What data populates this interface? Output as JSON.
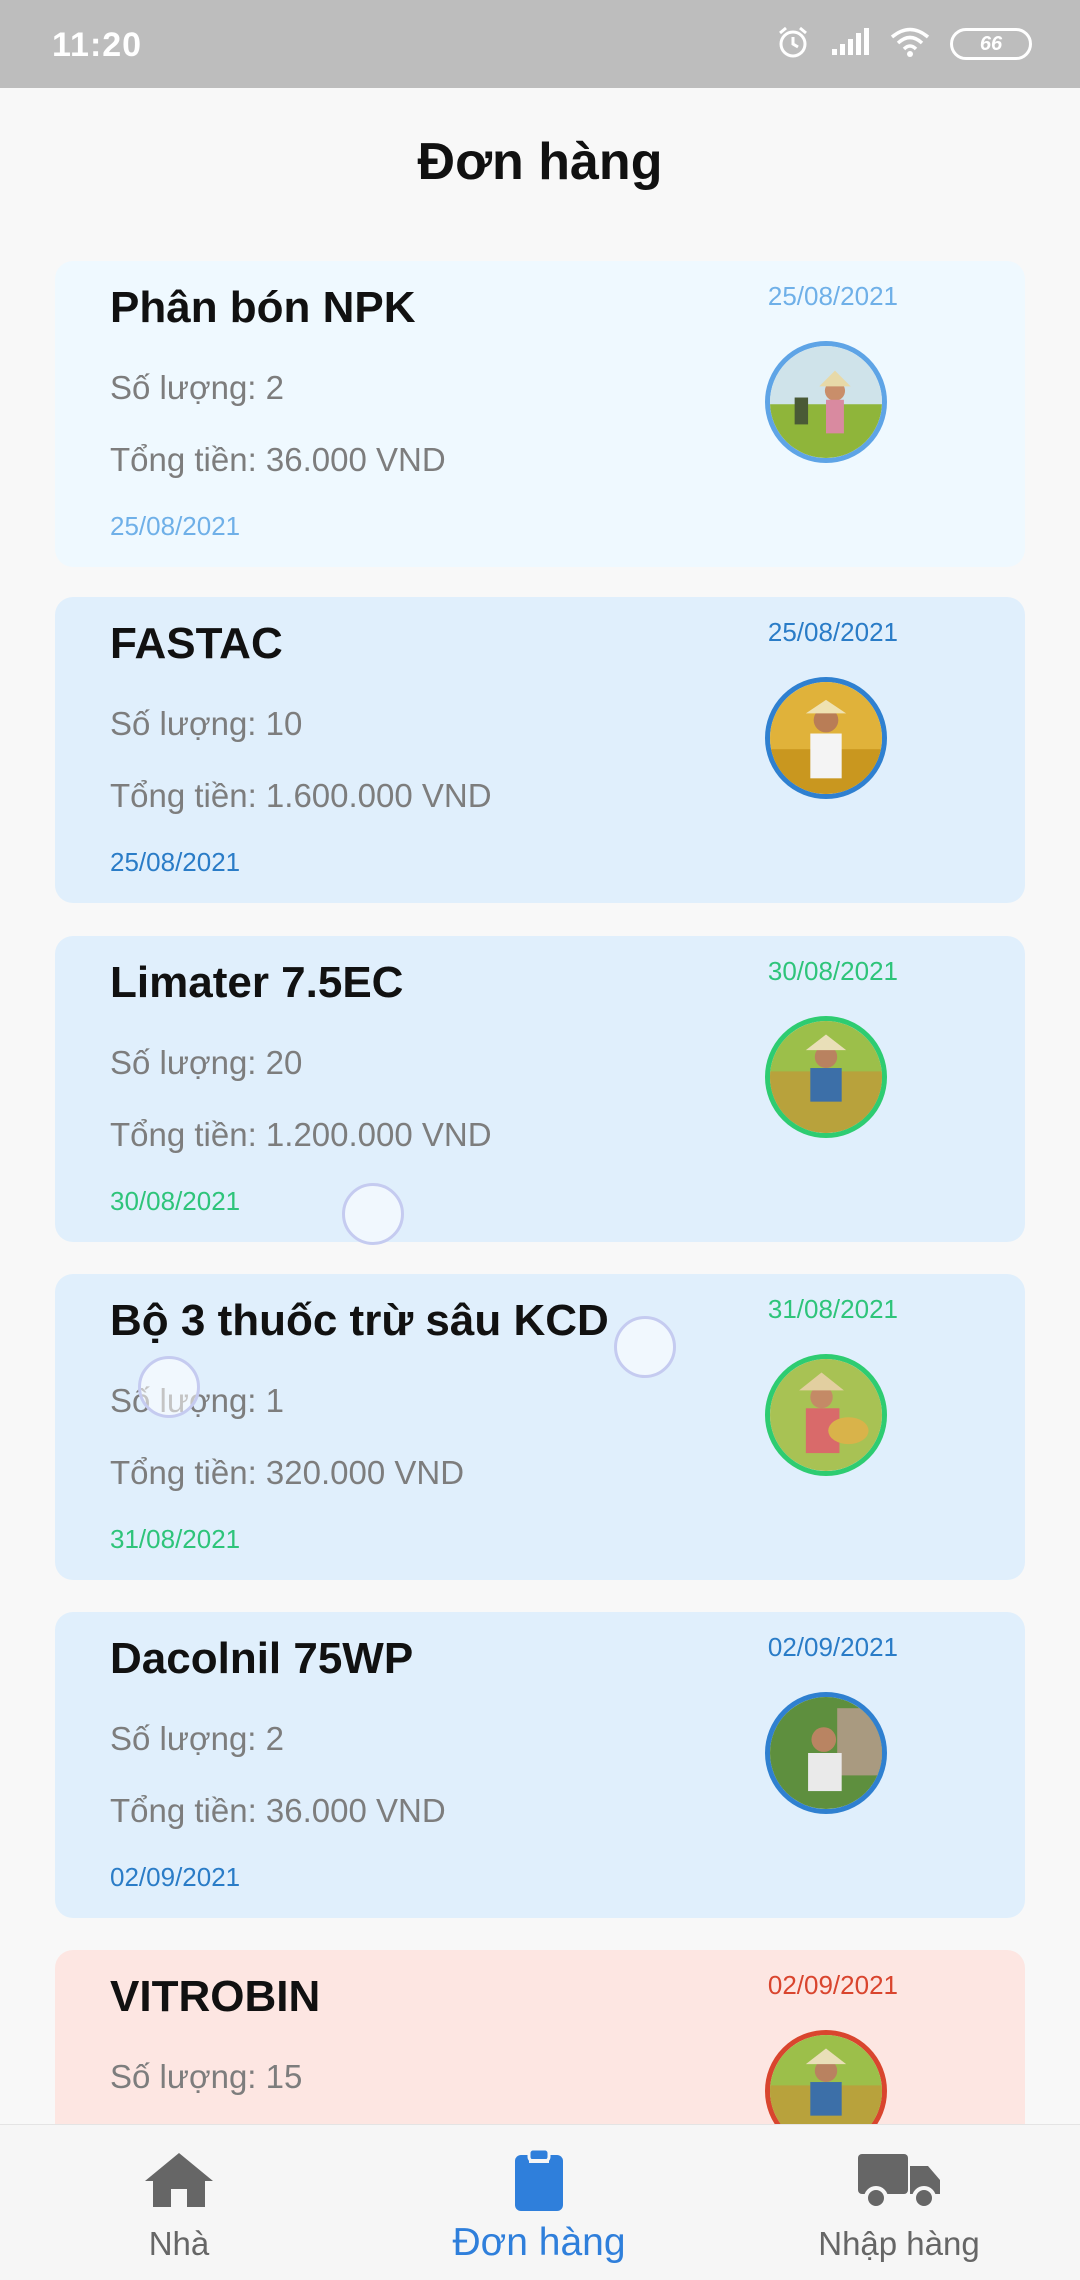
{
  "status_bar": {
    "time": "11:20",
    "battery": "66"
  },
  "page": {
    "title": "Đơn hàng"
  },
  "orders": [
    {
      "name": "Phân bón NPK",
      "quantity": "Số lượng: 2",
      "total": "Tổng tiền: 36.000 VND",
      "date": "25/08/2021",
      "bg": "#eff9ff",
      "date_color": "#6fb0e8",
      "ring": "#5ea4e6"
    },
    {
      "name": "FASTAC",
      "quantity": "Số lượng: 10",
      "total": "Tổng tiền: 1.600.000 VND",
      "date": "25/08/2021",
      "bg": "#e0effc",
      "date_color": "#2a7cc7",
      "ring": "#2f80d0"
    },
    {
      "name": "Limater 7.5EC",
      "quantity": "Số lượng: 20",
      "total": "Tổng tiền: 1.200.000 VND",
      "date": "30/08/2021",
      "bg": "#e0effc",
      "date_color": "#2ec47a",
      "ring": "#2ecc71"
    },
    {
      "name": "Bộ 3 thuốc trừ sâu KCD",
      "quantity": "Số lượng: 1",
      "total": "Tổng tiền: 320.000 VND",
      "date": "31/08/2021",
      "bg": "#e0effc",
      "date_color": "#2ec47a",
      "ring": "#2ecc71"
    },
    {
      "name": "Dacolnil 75WP",
      "quantity": "Số lượng: 2",
      "total": "Tổng tiền: 36.000 VND",
      "date": "02/09/2021",
      "bg": "#e0effc",
      "date_color": "#2a7cc7",
      "ring": "#2f80d0"
    },
    {
      "name": "VITROBIN",
      "quantity": "Số lượng: 15",
      "total": "",
      "date": "02/09/2021",
      "bg": "#fde6e2",
      "date_color": "#d9452e",
      "ring": "#d9452e"
    }
  ],
  "bottom_nav": {
    "home": "Nhà",
    "orders": "Đơn hàng",
    "import": "Nhập hàng",
    "active": "orders",
    "active_color": "#2f7fdb",
    "inactive_color": "#666666"
  },
  "icons": {
    "home": "home-icon",
    "orders": "clipboard-icon",
    "import": "truck-icon",
    "alarm": "alarm-icon",
    "signal": "signal-icon",
    "wifi": "wifi-icon",
    "battery": "battery-icon"
  }
}
